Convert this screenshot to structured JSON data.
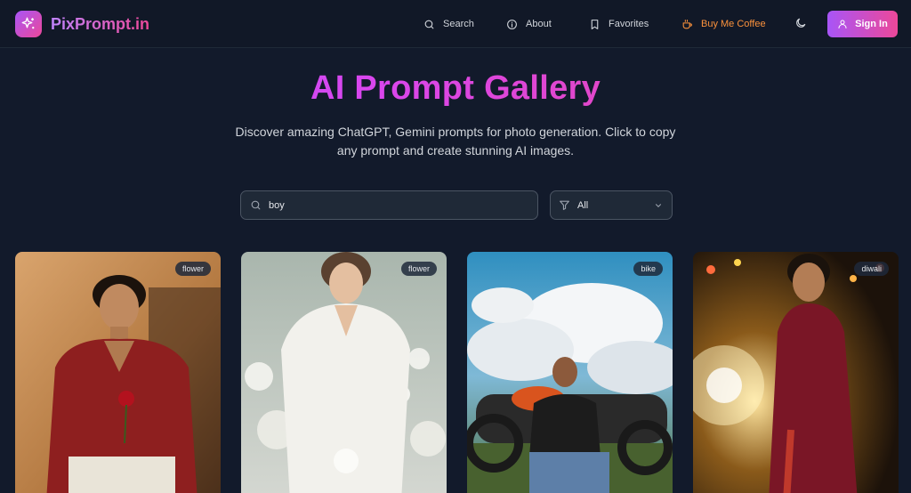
{
  "brand": {
    "name": "PixPrompt.in"
  },
  "nav": {
    "search": "Search",
    "about": "About",
    "favorites": "Favorites",
    "coffee": "Buy Me Coffee",
    "signin": "Sign In"
  },
  "hero": {
    "title": "AI Prompt Gallery",
    "subtitle": "Discover amazing ChatGPT, Gemini prompts for photo generation. Click to copy any prompt and create stunning AI images."
  },
  "search": {
    "value": "boy"
  },
  "filter": {
    "selected": "All"
  },
  "cards": [
    {
      "tag": "flower"
    },
    {
      "tag": "flower"
    },
    {
      "tag": "bike"
    },
    {
      "tag": "diwali"
    }
  ],
  "colors": {
    "accent_start": "#a855f7",
    "accent_end": "#ec4899",
    "coffee": "#fb923c",
    "background": "#121a2b"
  }
}
